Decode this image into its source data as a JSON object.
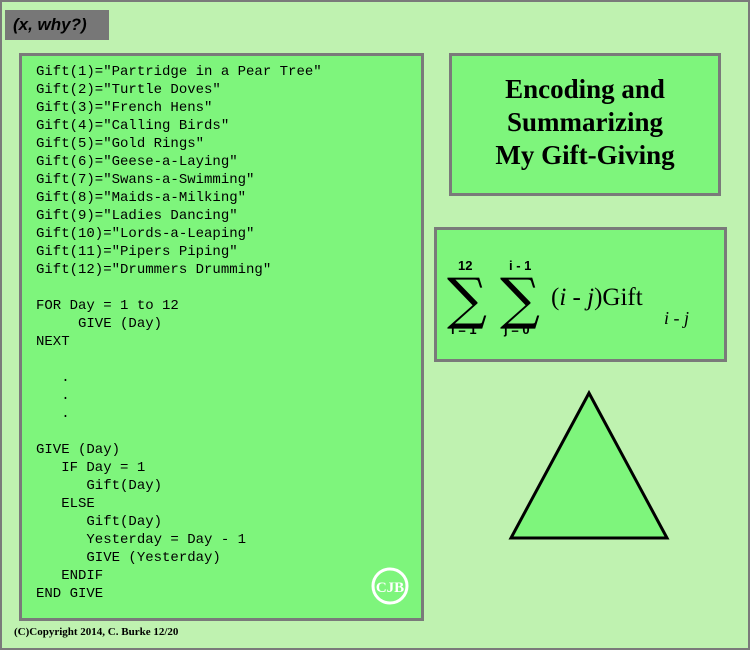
{
  "header": {
    "tag": "(x, why?)"
  },
  "code_panel": {
    "code": "Gift(1)=\"Partridge in a Pear Tree\"\nGift(2)=\"Turtle Doves\"\nGift(3)=\"French Hens\"\nGift(4)=\"Calling Birds\"\nGift(5)=\"Gold Rings\"\nGift(6)=\"Geese-a-Laying\"\nGift(7)=\"Swans-a-Swimming\"\nGift(8)=\"Maids-a-Milking\"\nGift(9)=\"Ladies Dancing\"\nGift(10)=\"Lords-a-Leaping\"\nGift(11)=\"Pipers Piping\"\nGift(12)=\"Drummers Drumming\"\n\nFOR Day = 1 to 12\n     GIVE (Day)\nNEXT\n\n   .\n   .\n   .\n\nGIVE (Day)\n   IF Day = 1\n      Gift(Day)\n   ELSE\n      Gift(Day)\n      Yesterday = Day - 1\n      GIVE (Yesterday)\n   ENDIF\nEND GIVE",
    "logo_text": "CJB"
  },
  "title_panel": {
    "lines": [
      "Encoding and",
      "Summarizing",
      "My Gift-Giving"
    ]
  },
  "formula": {
    "sum1_upper": "12",
    "sum1_lower": "i = 1",
    "sum2_upper": "i - 1",
    "sum2_lower": "j = 0",
    "expression_html": "(<i>i</i> - <i>j</i>)Gift",
    "subscript": "i - j"
  },
  "footer": {
    "copyright": "(C)Copyright 2014, C. Burke 12/20"
  },
  "colors": {
    "background": "#bff2b0",
    "panel": "#7ef57c",
    "border": "#7a7a7a",
    "tag": "#777777"
  }
}
